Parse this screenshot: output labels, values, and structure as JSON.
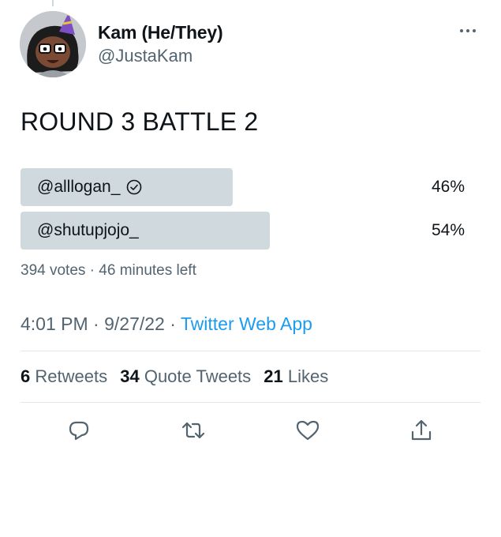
{
  "author": {
    "name": "Kam (He/They)",
    "handle": "@JustaKam"
  },
  "tweet": {
    "text": "ROUND 3 BATTLE 2"
  },
  "poll": {
    "options": [
      {
        "label": "@alllogan_",
        "percent_text": "46%",
        "share": 0.46,
        "verified": true
      },
      {
        "label": "@shutupjojo_",
        "percent_text": "54%",
        "share": 0.54,
        "verified": false
      }
    ],
    "votes": "394 votes",
    "separator": " · ",
    "time_left": "46 minutes left"
  },
  "timestamp": {
    "time": "4:01 PM",
    "sep": " · ",
    "date": "9/27/22",
    "source": "Twitter Web App"
  },
  "stats": {
    "retweets_count": "6",
    "retweets_label": "Retweets",
    "quotes_count": "34",
    "quotes_label": "Quote Tweets",
    "likes_count": "21",
    "likes_label": "Likes"
  },
  "actions": {
    "icons": [
      "reply-icon",
      "retweet-icon",
      "like-icon",
      "share-icon"
    ]
  },
  "colors": {
    "bar": "#cfd9de",
    "secondary_text": "#536471",
    "link": "#1d9bf0"
  }
}
